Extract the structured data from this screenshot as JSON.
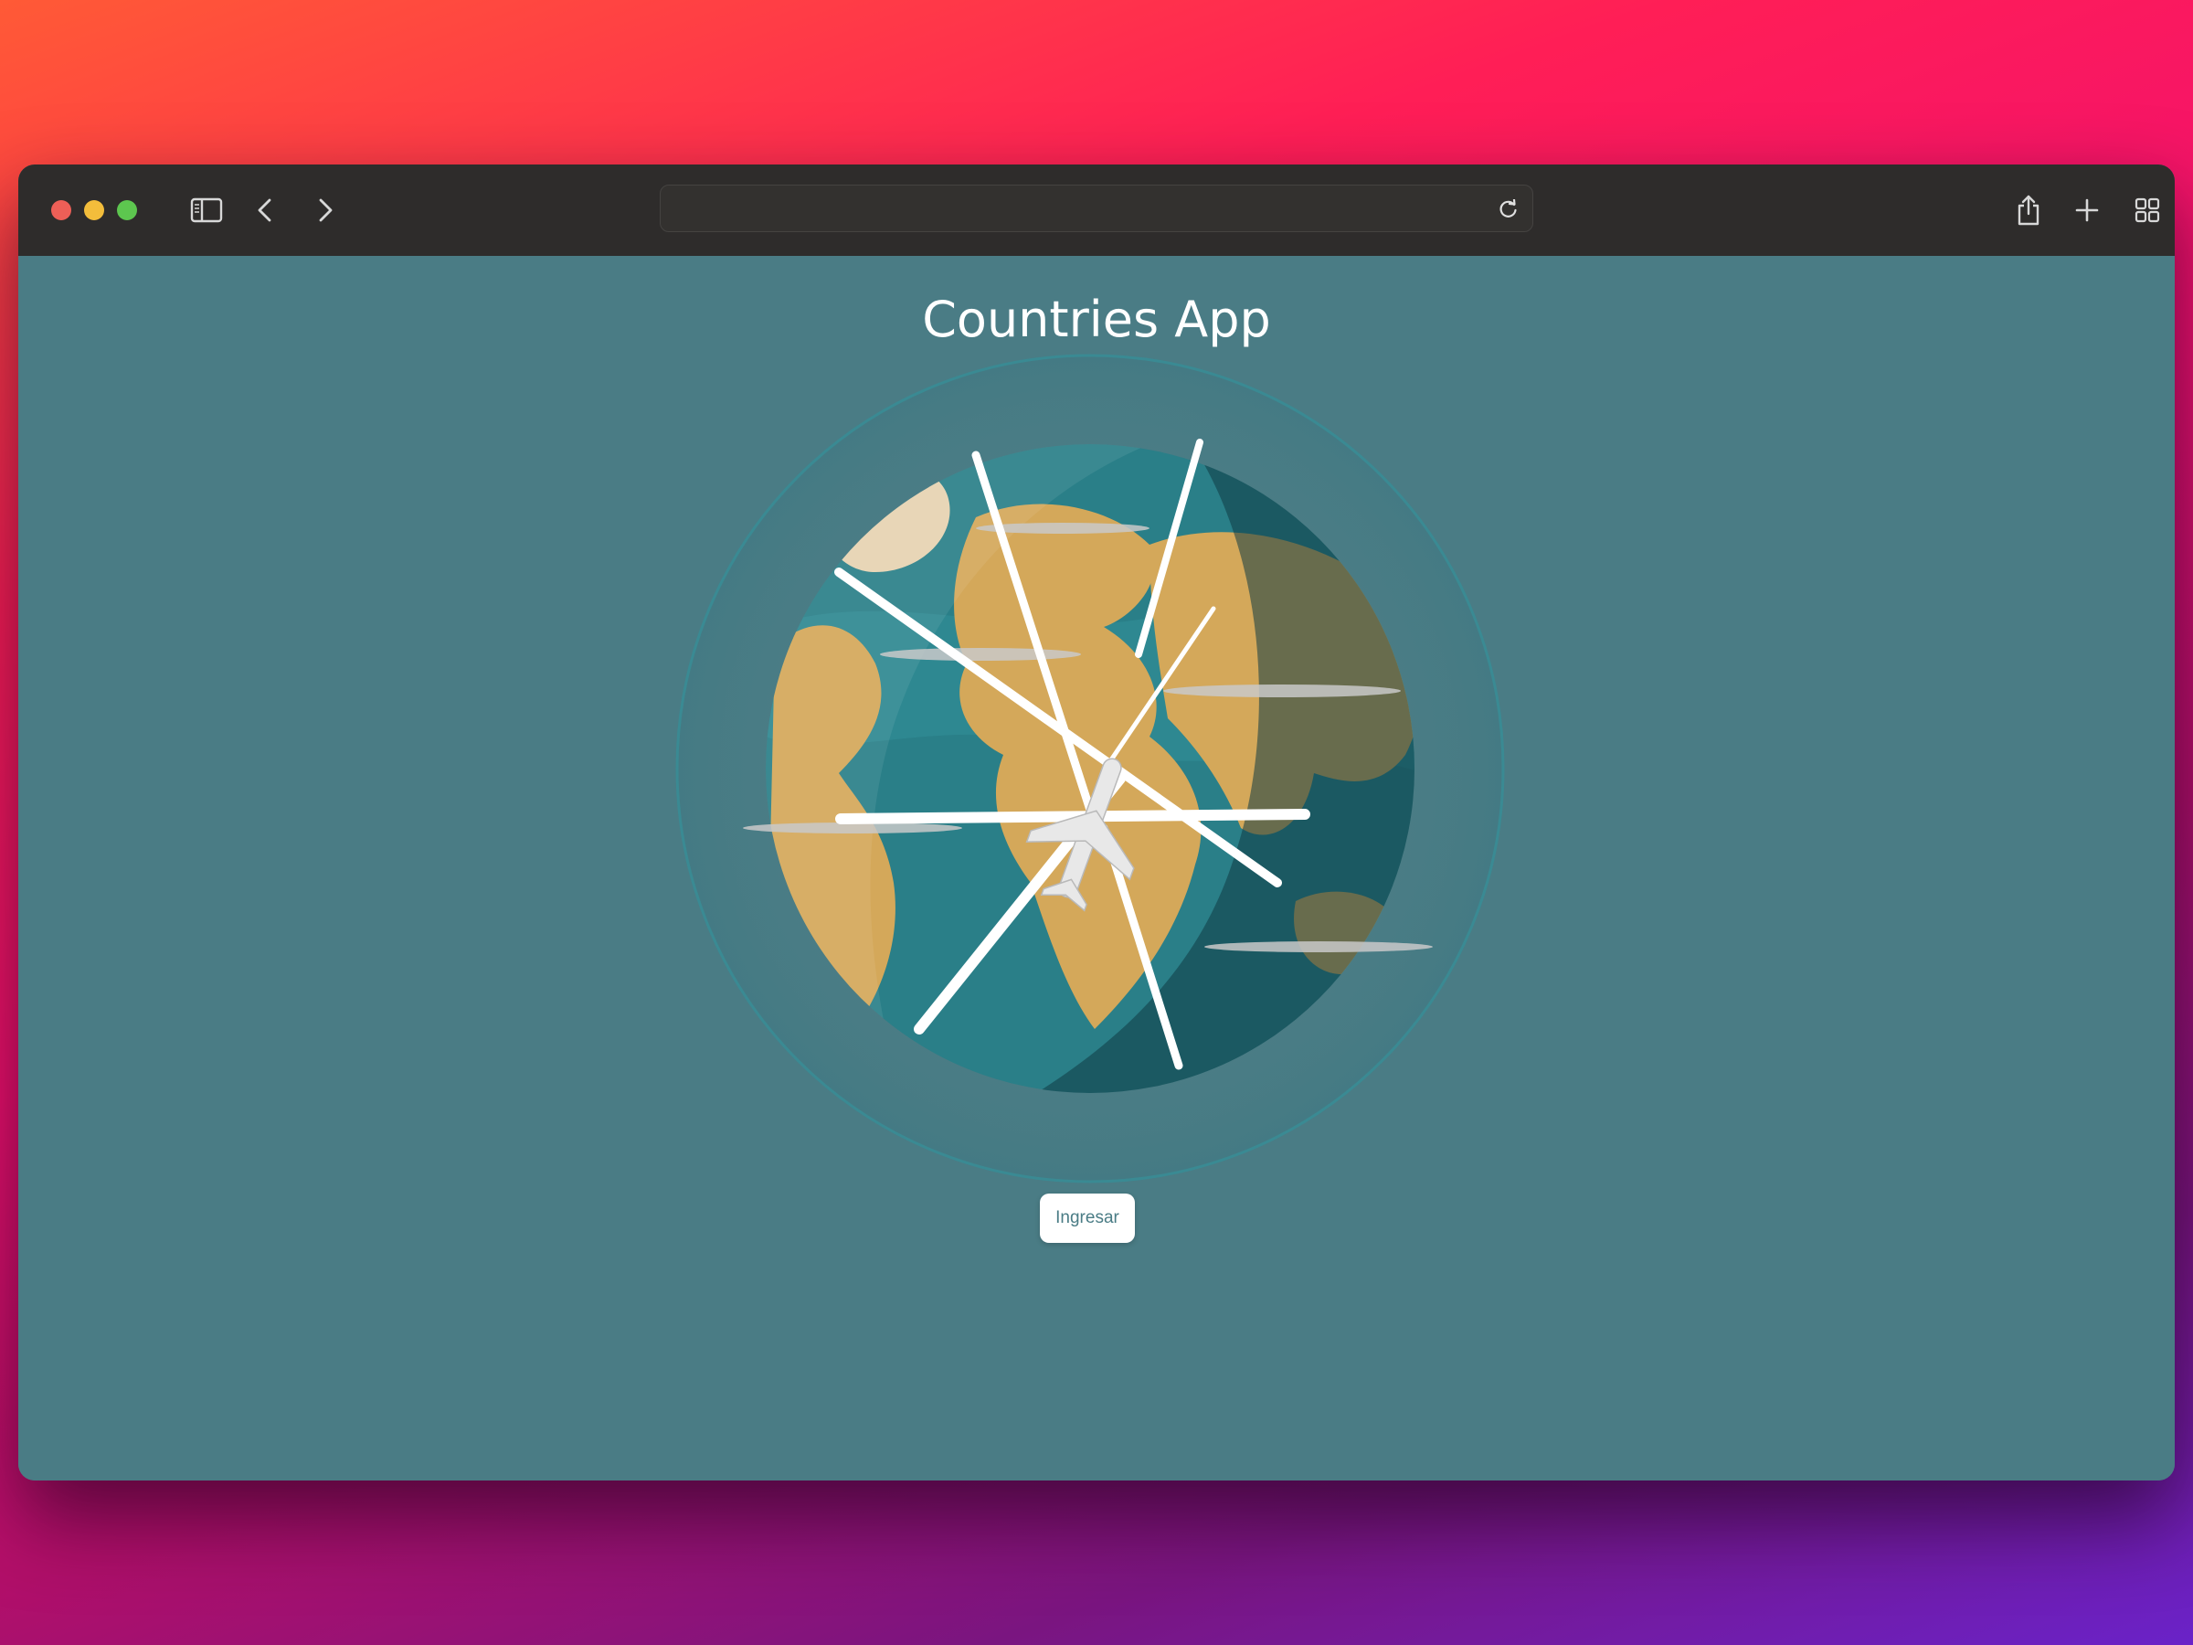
{
  "browser": {
    "address_value": "",
    "address_placeholder": "",
    "toolbar_icons": [
      "sidebar-icon",
      "back-arrow-icon",
      "forward-arrow-icon",
      "reload-icon",
      "share-icon",
      "new-tab-icon",
      "tab-overview-icon"
    ]
  },
  "page": {
    "title": "Countries App",
    "enter_button_label": "Ingresar",
    "background_color": "#4a7c85",
    "accent_color": "#4a7c85"
  },
  "illustration": {
    "subject": "globe-with-airplane-icon"
  }
}
